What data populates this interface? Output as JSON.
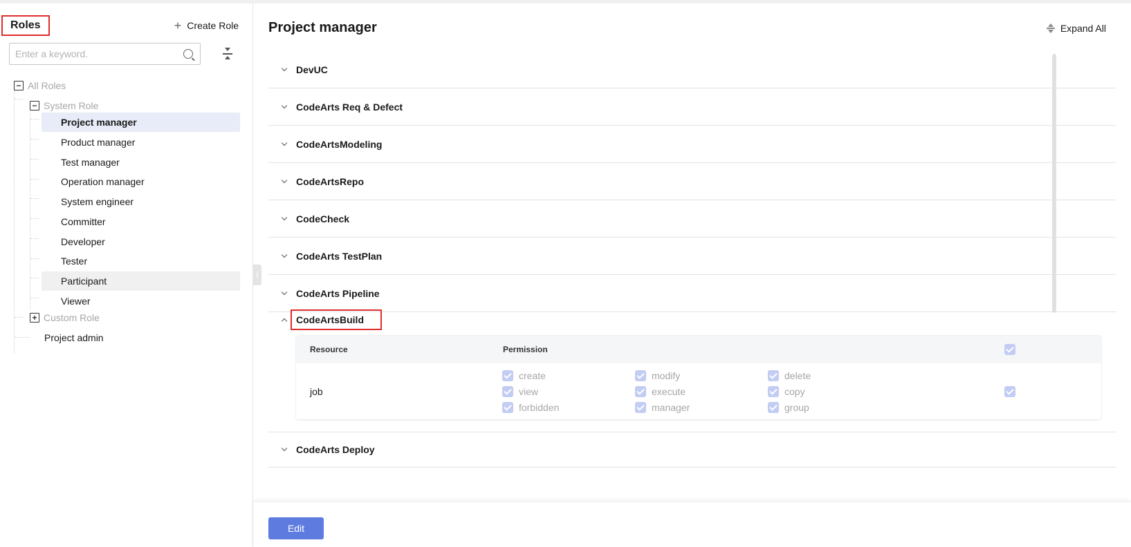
{
  "left_panel": {
    "title": "Roles",
    "create_role_label": "Create Role",
    "search_placeholder": "Enter a keyword.",
    "tree": {
      "root_label": "All Roles",
      "system_group_label": "System Role",
      "system_roles": [
        "Project manager",
        "Product manager",
        "Test manager",
        "Operation manager",
        "System engineer",
        "Committer",
        "Developer",
        "Tester",
        "Participant",
        "Viewer"
      ],
      "selected_role": "Project manager",
      "custom_group_label": "Custom Role",
      "project_admin_label": "Project admin"
    }
  },
  "main": {
    "title": "Project manager",
    "expand_all_label": "Expand All",
    "sections": [
      "DevUC",
      "CodeArts Req & Defect",
      "CodeArtsModeling",
      "CodeArtsRepo",
      "CodeCheck",
      "CodeArts TestPlan",
      "CodeArts Pipeline"
    ],
    "expanded_section": {
      "name": "CodeArtsBuild",
      "table": {
        "col_resource": "Resource",
        "col_permission": "Permission",
        "rows": [
          {
            "resource": "job",
            "permissions": [
              "create",
              "modify",
              "delete",
              "view",
              "execute",
              "copy",
              "forbidden",
              "manager",
              "group"
            ]
          }
        ]
      }
    },
    "after_sections": [
      "CodeArts Deploy"
    ]
  },
  "footer": {
    "edit_label": "Edit"
  },
  "colors": {
    "accent": "#5e7ce0",
    "selected_bg": "#e8ebf8",
    "highlight_border": "#e02b2b",
    "checkbox_disabled": "#c3ccf3"
  }
}
